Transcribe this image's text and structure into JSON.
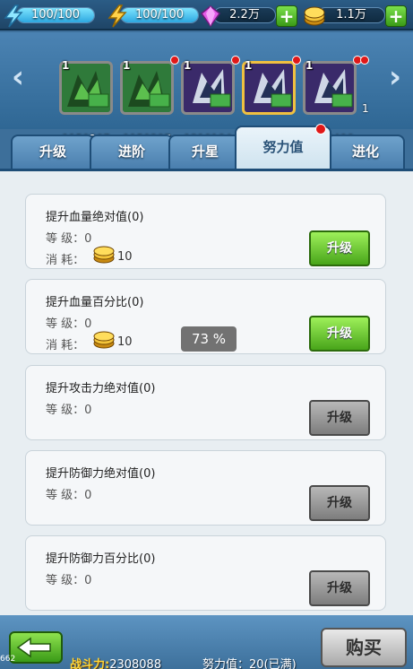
{
  "resources": {
    "stamina": "100/100",
    "energy": "100/100",
    "stamina_level": 1.0,
    "energy_level": 1.0,
    "gems": "2.2万",
    "gold": "1.1万",
    "plus": "+"
  },
  "hero_strip": {
    "prev": "‹",
    "next": "›",
    "heroes": [
      {
        "level": "1",
        "id": "150307",
        "prefix": "1"
      },
      {
        "level": "1",
        "id": "150307",
        "prefix": "1"
      },
      {
        "level": "1",
        "id": "210104",
        "prefix": "1"
      },
      {
        "level": "1",
        "id": "210104",
        "prefix": "1"
      },
      {
        "level": "1",
        "id": "280406",
        "prefix": "1"
      }
    ],
    "extra_prefix": "1"
  },
  "tabs": [
    "升级",
    "进阶",
    "升星",
    "努力值",
    "进化"
  ],
  "cards": [
    {
      "title": "提升血量绝对值(0)",
      "level_label": "等  级：",
      "level": "0",
      "cost_label": "消  耗：",
      "cost": "10",
      "button": "升级"
    },
    {
      "title": "提升血量百分比(0)",
      "level_label": "等  级：",
      "level": "0",
      "cost_label": "消  耗：",
      "cost": "10",
      "button": "升级"
    },
    {
      "title": "提升攻击力绝对值(0)",
      "level_label": "等  级：",
      "level": "0",
      "button": "升级"
    },
    {
      "title": "提升防御力绝对值(0)",
      "level_label": "等  级：",
      "level": "0",
      "button": "升级"
    },
    {
      "title": "提升防御力百分比(0)",
      "level_label": "等  级：",
      "level": "0",
      "button": "升级"
    }
  ],
  "progress_toast": "73 %",
  "footer": {
    "version": "662",
    "power_label": "战斗力:",
    "power_value": "2308088",
    "effort": "努力值：20(已满)",
    "buy": "购买"
  },
  "colors": {
    "bg": "#3d6f9a",
    "tab_active": "#cfe3ef",
    "btn_green": "#48a51a",
    "btn_grey": "#7d7d7d",
    "red_dot": "#e01818"
  }
}
